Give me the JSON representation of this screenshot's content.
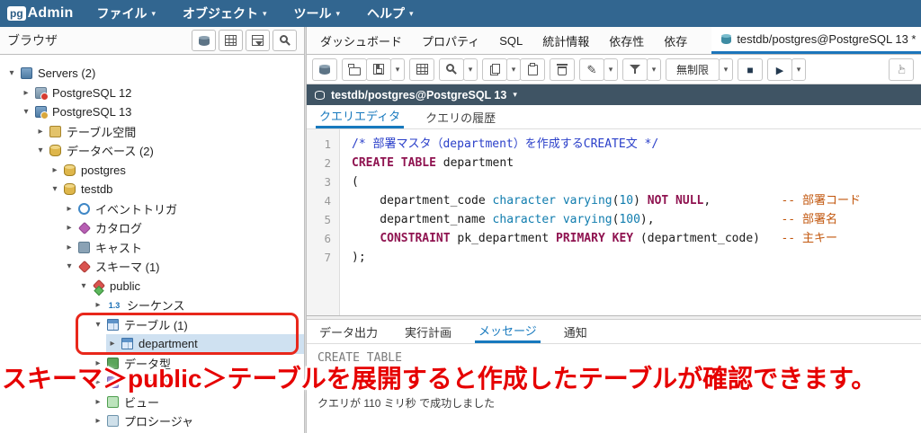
{
  "colors": {
    "header_bg": "#326690",
    "accent_blue": "#1b75bb",
    "annotation_red": "#e60000",
    "selection_bg": "#cfe1f1",
    "syntax_keyword": "#8f1350",
    "syntax_type": "#0f7cae",
    "syntax_block_comment": "#2a3fc9",
    "syntax_line_comment": "#c2570e"
  },
  "header": {
    "logo_pg": "pg",
    "logo_admin": "Admin",
    "menus": [
      {
        "id": "file",
        "label": "ファイル"
      },
      {
        "id": "object",
        "label": "オブジェクト"
      },
      {
        "id": "tools",
        "label": "ツール"
      },
      {
        "id": "help",
        "label": "ヘルプ"
      }
    ]
  },
  "browser": {
    "title": "ブラウザ",
    "buttons": [
      {
        "name": "quick-server-button",
        "icon": "cylinder"
      },
      {
        "name": "object-grid-button",
        "icon": "grid"
      },
      {
        "name": "filtered-rows-button",
        "icon": "gridfunnel"
      },
      {
        "name": "search-objects-button",
        "icon": "search"
      }
    ]
  },
  "tree": {
    "items": [
      {
        "label": "Servers (2)",
        "level": 0,
        "expand": "open",
        "icon": "servers"
      },
      {
        "label": "PostgreSQL 12",
        "level": 1,
        "expand": "closed",
        "icon": "server-off"
      },
      {
        "label": "PostgreSQL 13",
        "level": 1,
        "expand": "open",
        "icon": "server-on"
      },
      {
        "label": "テーブル空間",
        "level": 2,
        "expand": "closed",
        "icon": "tablespace"
      },
      {
        "label": "データベース (2)",
        "level": 2,
        "expand": "open",
        "icon": "databases"
      },
      {
        "label": "postgres",
        "level": 3,
        "expand": "closed",
        "icon": "database"
      },
      {
        "label": "testdb",
        "level": 3,
        "expand": "open",
        "icon": "database"
      },
      {
        "label": "イベントトリガ",
        "level": 4,
        "expand": "closed",
        "icon": "event-trigger"
      },
      {
        "label": "カタログ",
        "level": 4,
        "expand": "closed",
        "icon": "catalog"
      },
      {
        "label": "キャスト",
        "level": 4,
        "expand": "closed",
        "icon": "cast"
      },
      {
        "label": "スキーマ (1)",
        "level": 4,
        "expand": "open",
        "icon": "schemas"
      },
      {
        "label": "public",
        "level": 5,
        "expand": "open",
        "icon": "schema"
      },
      {
        "label": "シーケンス",
        "level": 6,
        "expand": "closed",
        "icon": "sequence",
        "icon_text": "1.3"
      },
      {
        "label": "テーブル (1)",
        "level": 6,
        "expand": "open",
        "icon": "tables"
      },
      {
        "label": "department",
        "level": 7,
        "expand": "closed",
        "icon": "table",
        "selected": true
      },
      {
        "label": "データ型",
        "level": 6,
        "expand": "closed",
        "icon": "types"
      },
      {
        "label": "トリガ関数",
        "level": 6,
        "expand": "closed",
        "icon": "trigger-fn"
      },
      {
        "label": "ビュー",
        "level": 6,
        "expand": "closed",
        "icon": "views"
      },
      {
        "label": "プロシージャ",
        "level": 6,
        "expand": "closed",
        "icon": "procedures"
      }
    ]
  },
  "main_tabs": {
    "items": [
      {
        "label": "ダッシュボード"
      },
      {
        "label": "プロパティ"
      },
      {
        "label": "SQL"
      },
      {
        "label": "統計情報"
      },
      {
        "label": "依存性"
      },
      {
        "label": "依存"
      }
    ],
    "active": {
      "label": "testdb/postgres@PostgreSQL 13 *"
    }
  },
  "query_toolbar": {
    "groups": [
      {
        "buttons": [
          {
            "name": "macros-button",
            "icon": "cylinder"
          }
        ]
      },
      {
        "buttons": [
          {
            "name": "open-file-button",
            "icon": "folder"
          },
          {
            "name": "save-button",
            "icon": "save",
            "caret": true
          }
        ]
      },
      {
        "buttons": [
          {
            "name": "edit-grid-button",
            "icon": "grid"
          }
        ]
      },
      {
        "buttons": [
          {
            "name": "find-button",
            "icon": "search",
            "caret": true
          }
        ]
      },
      {
        "buttons": [
          {
            "name": "copy-button",
            "icon": "copy",
            "caret": true
          },
          {
            "name": "paste-button",
            "icon": "paste"
          }
        ]
      },
      {
        "buttons": [
          {
            "name": "delete-button",
            "icon": "trash"
          }
        ]
      },
      {
        "buttons": [
          {
            "name": "edit-button",
            "icon": "pencil",
            "caret": true
          }
        ]
      },
      {
        "buttons": [
          {
            "name": "filter-button",
            "icon": "funnel",
            "caret": true
          }
        ]
      },
      {
        "buttons": [
          {
            "name": "row-limit-select",
            "label": "無制限",
            "caret": true
          }
        ]
      },
      {
        "buttons": [
          {
            "name": "cancel-query-button",
            "icon": "stop"
          }
        ]
      },
      {
        "buttons": [
          {
            "name": "execute-button",
            "icon": "play",
            "caret": true
          }
        ]
      },
      {
        "push_right": true,
        "buttons": [
          {
            "name": "pointer-mode-button",
            "icon": "hand"
          }
        ]
      }
    ]
  },
  "connection": {
    "label": "testdb/postgres@PostgreSQL 13"
  },
  "editor_tabs": {
    "query": "クエリエディタ",
    "history": "クエリの履歴"
  },
  "editor": {
    "lines": [
      {
        "no": 1,
        "tokens": [
          {
            "t": "/* 部署マスタ（department）を作成するCREATE文 */",
            "c": "cb"
          }
        ]
      },
      {
        "no": 2,
        "tokens": [
          {
            "t": "CREATE TABLE",
            "c": "k"
          },
          {
            "t": " department",
            "c": ""
          }
        ]
      },
      {
        "no": 3,
        "tokens": [
          {
            "t": "(",
            "c": ""
          }
        ]
      },
      {
        "no": 4,
        "tokens": [
          {
            "t": "    department_code ",
            "c": ""
          },
          {
            "t": "character varying",
            "c": "ty"
          },
          {
            "t": "(",
            "c": ""
          },
          {
            "t": "10",
            "c": "n"
          },
          {
            "t": ") ",
            "c": ""
          },
          {
            "t": "NOT NULL",
            "c": "k"
          },
          {
            "t": ",          ",
            "c": ""
          },
          {
            "t": "-- 部署コード",
            "c": "cl"
          }
        ]
      },
      {
        "no": 5,
        "tokens": [
          {
            "t": "    department_name ",
            "c": ""
          },
          {
            "t": "character varying",
            "c": "ty"
          },
          {
            "t": "(",
            "c": ""
          },
          {
            "t": "100",
            "c": "n"
          },
          {
            "t": "),                  ",
            "c": ""
          },
          {
            "t": "-- 部署名",
            "c": "cl"
          }
        ]
      },
      {
        "no": 6,
        "tokens": [
          {
            "t": "    ",
            "c": ""
          },
          {
            "t": "CONSTRAINT",
            "c": "k"
          },
          {
            "t": " pk_department ",
            "c": ""
          },
          {
            "t": "PRIMARY KEY",
            "c": "k"
          },
          {
            "t": " (department_code)   ",
            "c": ""
          },
          {
            "t": "-- 主キー",
            "c": "cl"
          }
        ]
      },
      {
        "no": 7,
        "tokens": [
          {
            "t": ");",
            "c": ""
          }
        ]
      }
    ]
  },
  "bottom_tabs": {
    "items": [
      {
        "label": "データ出力"
      },
      {
        "label": "実行計画"
      },
      {
        "label": "メッセージ",
        "active": true
      },
      {
        "label": "通知"
      }
    ]
  },
  "messages": {
    "result": "CREATE TABLE",
    "status": "クエリが 110 ミリ秒 で成功しました"
  },
  "annotation": {
    "text": "スキーマ＞public＞テーブルを展開すると作成したテーブルが確認できます。"
  }
}
